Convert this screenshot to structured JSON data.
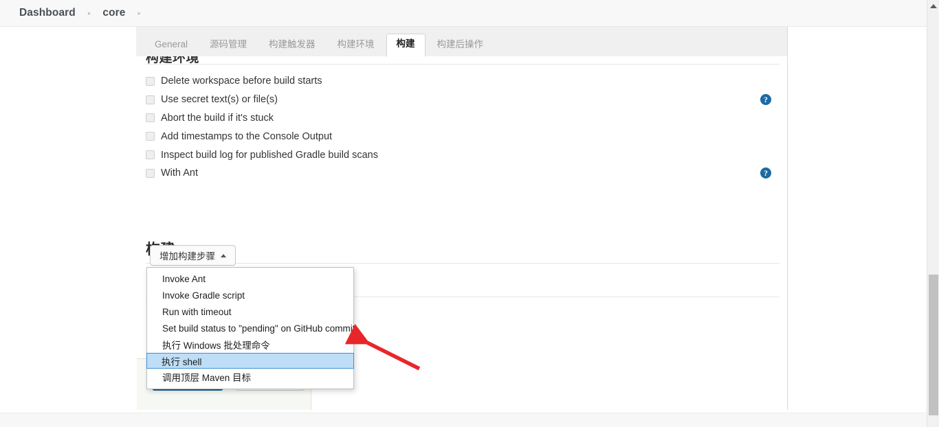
{
  "breadcrumb": {
    "items": [
      {
        "label": "Dashboard",
        "icon": "chevron-right-icon"
      },
      {
        "label": "core",
        "icon": "chevron-right-icon"
      }
    ],
    "separator": "▸"
  },
  "tabs": [
    {
      "label": "General",
      "active": false
    },
    {
      "label": "源码管理",
      "active": false
    },
    {
      "label": "构建触发器",
      "active": false
    },
    {
      "label": "构建环境",
      "active": false
    },
    {
      "label": "构建",
      "active": true
    },
    {
      "label": "构建后操作",
      "active": false
    }
  ],
  "form": {
    "clipped_heading": "构建环境",
    "checkboxes": [
      {
        "label": "Delete workspace before build starts",
        "checked": false,
        "help": false
      },
      {
        "label": "Use secret text(s) or file(s)",
        "checked": false,
        "help": true
      },
      {
        "label": "Abort the build if it's stuck",
        "checked": false,
        "help": false
      },
      {
        "label": "Add timestamps to the Console Output",
        "checked": false,
        "help": false
      },
      {
        "label": "Inspect build log for published Gradle build scans",
        "checked": false,
        "help": false
      },
      {
        "label": "With Ant",
        "checked": false,
        "help": true
      }
    ],
    "help_glyph": "?"
  },
  "build_section": {
    "title": "构建",
    "add_step_button": "增加构建步骤",
    "add_step_caret": "caret-up-icon"
  },
  "step_menu": {
    "items": [
      {
        "label": "Invoke Ant",
        "selected": false
      },
      {
        "label": "Invoke Gradle script",
        "selected": false
      },
      {
        "label": "Run with timeout",
        "selected": false
      },
      {
        "label": "Set build status to \"pending\" on GitHub commit",
        "selected": false
      },
      {
        "label": "执行 Windows 批处理命令",
        "selected": false
      },
      {
        "label": "执行 shell",
        "selected": true
      },
      {
        "label": "调用顶层 Maven 目标",
        "selected": false
      }
    ]
  },
  "save_bar": {
    "save_label": "",
    "apply_label": ""
  },
  "scrollbar": {
    "up_arrow": "caret-up-icon",
    "thumb_position": "400"
  },
  "colors": {
    "accent_blue": "#1c6ba4",
    "selection_fill": "#bedef7",
    "selection_border": "#3c8fd4",
    "annotation_red": "#e8262a",
    "tab_bg": "#f0f0f0",
    "save_bar_bg": "#f6f8f4"
  }
}
